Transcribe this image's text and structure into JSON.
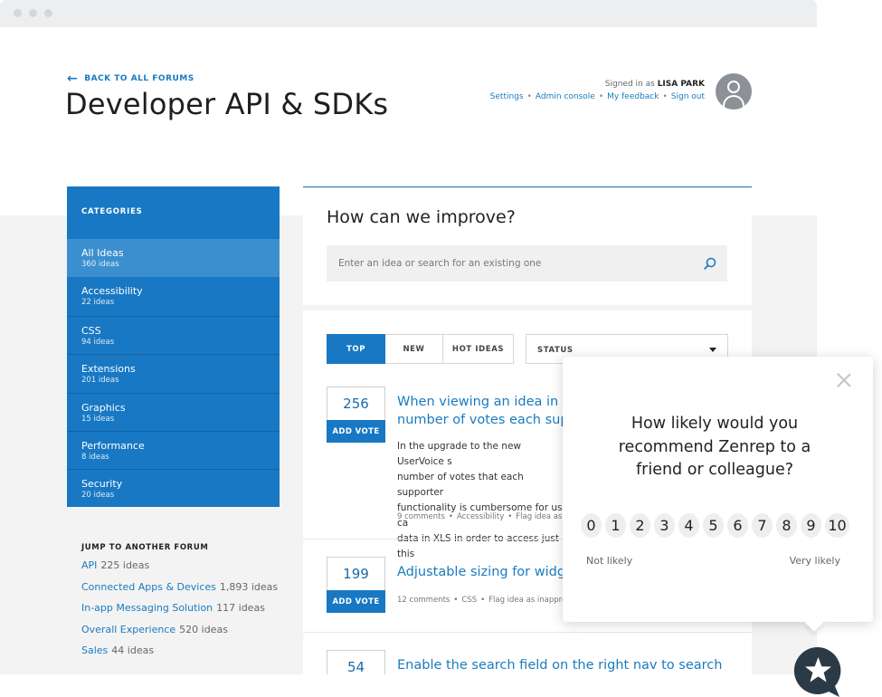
{
  "header": {
    "back_link": "BACK TO ALL FORUMS",
    "title": "Developer API & SDKs",
    "signed_in_prefix": "Signed in as",
    "user_name": "LISA PARK",
    "links": [
      "Settings",
      "Admin console",
      "My feedback",
      "Sign out"
    ]
  },
  "sidebar": {
    "categories_title": "CATEGORIES",
    "categories": [
      {
        "name": "All Ideas",
        "count": "360 ideas"
      },
      {
        "name": "Accessibility",
        "count": "22 ideas"
      },
      {
        "name": "CSS",
        "count": "94 ideas"
      },
      {
        "name": "Extensions",
        "count": "201 ideas"
      },
      {
        "name": "Graphics",
        "count": "15 ideas"
      },
      {
        "name": "Performance",
        "count": "8 ideas"
      },
      {
        "name": "Security",
        "count": "20 ideas"
      }
    ],
    "jump_title": "JUMP TO ANOTHER FORUM",
    "forums": [
      {
        "name": "API",
        "count": "225 ideas"
      },
      {
        "name": "Connected Apps & Devices",
        "count": "1,893 ideas"
      },
      {
        "name": "In-app Messaging Solution",
        "count": "117 ideas"
      },
      {
        "name": "Overall Experience",
        "count": "520 ideas"
      },
      {
        "name": "Sales",
        "count": "44 ideas"
      }
    ]
  },
  "improve": {
    "title": "How can we improve?",
    "search_placeholder": "Enter an idea or search for an existing one"
  },
  "tabs": [
    "TOP",
    "NEW",
    "HOT IDEAS"
  ],
  "status_label": "STATUS",
  "ideas": [
    {
      "votes": "256",
      "vote_label": "ADD VOTE",
      "title_line1": "When viewing an idea in Ad",
      "title_line2": "number of votes each supp",
      "body": [
        "In the upgrade to the new UserVoice s",
        "number of votes that each supporter",
        "functionality is cumbersome for us, ca",
        "data in XLS in order to access just this"
      ],
      "meta": [
        "9 comments",
        "Accessibility",
        "Flag idea as inap"
      ]
    },
    {
      "votes": "199",
      "vote_label": "ADD VOTE",
      "title_line1": "Adjustable sizing for widge",
      "meta": [
        "12 comments",
        "CSS",
        "Flag idea as inappropri"
      ]
    },
    {
      "votes": "54",
      "title_line1": "Enable the search field on the right nav to search"
    }
  ],
  "nps": {
    "question": "How likely would you recommend Zenrep to a friend or colleague?",
    "scale": [
      "0",
      "1",
      "2",
      "3",
      "4",
      "5",
      "6",
      "7",
      "8",
      "9",
      "10"
    ],
    "low_label": "Not likely",
    "high_label": "Very likely"
  },
  "colors": {
    "brand_blue": "#1878c3",
    "link_blue": "#1a7bbf",
    "active_category": "#3b8fcf",
    "launcher_dark": "#2b3a46"
  },
  "icons": {
    "back": "arrow-left-icon",
    "search": "search-icon",
    "close": "close-icon",
    "launcher": "star-icon",
    "avatar": "user-icon"
  }
}
